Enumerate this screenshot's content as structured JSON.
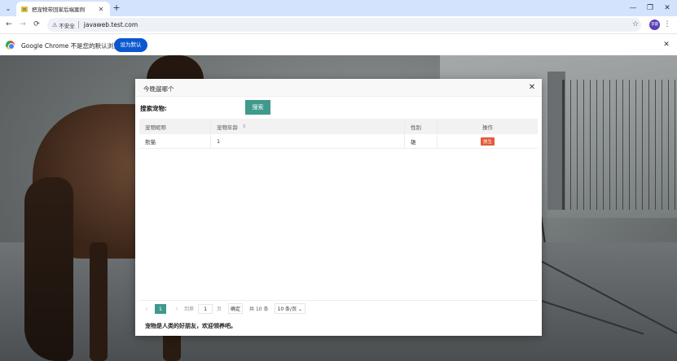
{
  "browser": {
    "tab_title": "把宠物带回家后端案例",
    "menu_icon": "chevron-down-icon",
    "new_tab": "+",
    "minimize": "—",
    "restore": "❐",
    "close": "✕",
    "back": "←",
    "forward": "→",
    "reload": "⟳",
    "security_label": "不安全",
    "url": "javaweb.test.com",
    "star": "☆",
    "avatar_text": "李雷",
    "more": "⋮"
  },
  "infobar": {
    "message": "Google Chrome 不是您的默认浏览器",
    "button": "设为默认",
    "close": "✕"
  },
  "modal": {
    "title": "今晚遛哪个",
    "close": "✕",
    "search_label": "搜索宠物:",
    "search_value": "",
    "search_button": "搜索",
    "table": {
      "headers": [
        "宠物昵称",
        "宠物年龄",
        "性别",
        "操作"
      ],
      "sort_icon": "⇕",
      "rows": [
        {
          "name": "熊猫",
          "age": "1",
          "gender": "雄",
          "action": "放生"
        }
      ]
    },
    "pager": {
      "prev": "‹",
      "current": "1",
      "next": "›",
      "goto_label": "到第",
      "goto_value": "1",
      "page_unit": "页",
      "confirm": "确定",
      "total": "共 10 条",
      "page_size": "10 条/页 ⌄"
    },
    "footer": "宠物是人类的好朋友，欢迎领养吧。"
  },
  "colors": {
    "accent": "#3f9a8c",
    "danger": "#e25b3a",
    "chrome_blue": "#0b57d0",
    "tab_strip": "#d3e3fd"
  }
}
